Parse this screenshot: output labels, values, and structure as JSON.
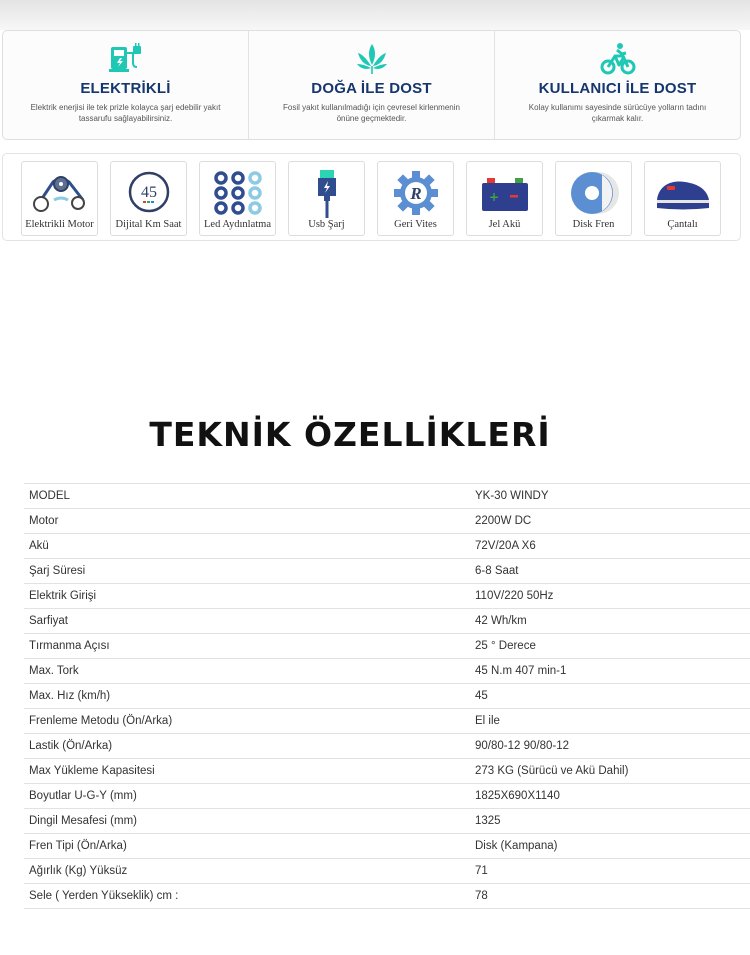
{
  "features": [
    {
      "title": "ELEKTRİKLİ",
      "desc": "Elektrik enerjisi ile tek prizle kolayca şarj edebilir yakıt tassarufu sağlayabilirsiniz.",
      "icon": "ev-charger-icon"
    },
    {
      "title": "DOĞA İLE DOST",
      "desc": "Fosil yakıt kullanılmadığı için çevresel kirlenmenin önüne geçmektedir.",
      "icon": "leaf-icon"
    },
    {
      "title": "KULLANICI İLE DOST",
      "desc": "Kolay kullanımı sayesinde sürücüye yolların tadını çıkarmak kalır.",
      "icon": "bike-rider-icon"
    }
  ],
  "icon_cards": [
    {
      "label": "Elektrikli Motor",
      "icon": "motor-belt-icon"
    },
    {
      "label": "Dijital Km Saat",
      "icon": "speedometer-icon",
      "value": "45"
    },
    {
      "label": "Led Aydınlatma",
      "icon": "led-grid-icon"
    },
    {
      "label": "Usb Şarj",
      "icon": "usb-cable-icon"
    },
    {
      "label": "Geri Vites",
      "icon": "reverse-gear-icon",
      "value": "R"
    },
    {
      "label": "Jel Akü",
      "icon": "battery-icon"
    },
    {
      "label": "Disk Fren",
      "icon": "disc-brake-icon"
    },
    {
      "label": "Çantalı",
      "icon": "top-case-icon"
    }
  ],
  "heading": "TEKNİK ÖZELLİKLERİ",
  "specs": [
    {
      "k": "MODEL",
      "v": "YK-30 WINDY"
    },
    {
      "k": "Motor",
      "v": "2200W DC"
    },
    {
      "k": "Akü",
      "v": "72V/20A X6"
    },
    {
      "k": "Şarj Süresi",
      "v": "6-8 Saat"
    },
    {
      "k": "Elektrik Girişi",
      "v": "110V/220 50Hz"
    },
    {
      "k": "Sarfiyat",
      "v": "42 Wh/km"
    },
    {
      "k": "Tırmanma Açısı",
      "v": "25 ° Derece"
    },
    {
      "k": "Max. Tork",
      "v": "45 N.m 407 min-1"
    },
    {
      "k": "Max. Hız (km/h)",
      "v": "45"
    },
    {
      "k": "Frenleme Metodu (Ön/Arka)",
      "v": "El ile"
    },
    {
      "k": "Lastik (Ön/Arka)",
      "v": "90/80-12 90/80-12"
    },
    {
      "k": "Max Yükleme Kapasitesi",
      "v": "273 KG (Sürücü ve Akü Dahil)"
    },
    {
      "k": "Boyutlar U-G-Y (mm)",
      "v": "1825X690X1140"
    },
    {
      "k": "Dingil Mesafesi (mm)",
      "v": "1325"
    },
    {
      "k": "Fren Tipi (Ön/Arka)",
      "v": "Disk (Kampana)"
    },
    {
      "k": "Ağırlık (Kg) Yüksüz",
      "v": "71"
    },
    {
      "k": "Sele ( Yerden Yükseklik) cm :",
      "v": "78"
    }
  ],
  "colors": {
    "navy": "#16366f",
    "teal": "#1ec8b4",
    "icon_blue": "#2f4d8f",
    "icon_light": "#8ccbe3",
    "red": "#e53935"
  }
}
